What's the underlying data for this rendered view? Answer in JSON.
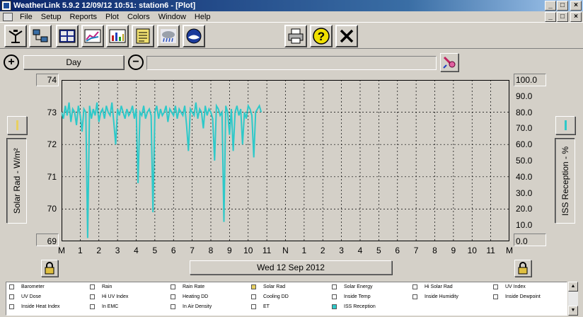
{
  "window": {
    "title": "WeatherLink 5.9.2  12/09/12  10:51: station6 - [Plot]",
    "cap_min": "_",
    "cap_max": "□",
    "cap_close": "×"
  },
  "menu": [
    "File",
    "Setup",
    "Reports",
    "Plot",
    "Colors",
    "Window",
    "Help"
  ],
  "toolbar_icons": [
    "station-icon",
    "network-icon",
    "bulletin-icon",
    "chart-icon",
    "plot-icon",
    "notes-icon",
    "weather-icon",
    "noaa-icon",
    "print-icon",
    "help-icon",
    "close-icon"
  ],
  "zoom": {
    "in_symbol": "+",
    "out_symbol": "−",
    "period_label": "Day",
    "selection_value": ""
  },
  "left_axis": {
    "title": "Solar Rad - W/m²",
    "ticks": [
      "74",
      "73",
      "72",
      "71",
      "70",
      "69"
    ]
  },
  "right_axis": {
    "title": "ISS Reception - %",
    "ticks": [
      "100.0",
      "90.0",
      "80.0",
      "70.0",
      "60.0",
      "50.0",
      "40.0",
      "30.0",
      "20.0",
      "10.0",
      "0.0"
    ]
  },
  "x_axis": {
    "ticks": [
      "M",
      "1",
      "2",
      "3",
      "4",
      "5",
      "6",
      "7",
      "8",
      "9",
      "10",
      "11",
      "N",
      "1",
      "2",
      "3",
      "4",
      "5",
      "6",
      "7",
      "8",
      "9",
      "10",
      "11",
      "M"
    ]
  },
  "date_label": "Wed 12 Sep 2012",
  "series_color": "#2ec9c9",
  "chart_data": {
    "type": "line",
    "series": [
      {
        "x": [
          0,
          0.1,
          0.2,
          0.3,
          0.4,
          0.5,
          0.6,
          0.7,
          0.8,
          0.9,
          1.0,
          1.1,
          1.2,
          1.3,
          1.4,
          1.5,
          1.6,
          1.7,
          1.8,
          1.9,
          2.0,
          2.1,
          2.2,
          2.3,
          2.4,
          2.5,
          2.6,
          2.7,
          2.8,
          2.9,
          3.0,
          3.1,
          3.2,
          3.3,
          3.4,
          3.5,
          3.6,
          3.7,
          3.8,
          3.9,
          4.0,
          4.1,
          4.2,
          4.3,
          4.4,
          4.5,
          4.6,
          4.7,
          4.8,
          4.9,
          5.0,
          5.1,
          5.2,
          5.3,
          5.4,
          5.5,
          5.6,
          5.7,
          5.8,
          5.9,
          6.0,
          6.1,
          6.2,
          6.3,
          6.4,
          6.5,
          6.6,
          6.7,
          6.8,
          6.9,
          7.0,
          7.1,
          7.2,
          7.3,
          7.4,
          7.5,
          7.6,
          7.7,
          7.8,
          7.9,
          8.0,
          8.1,
          8.2,
          8.3,
          8.4,
          8.5,
          8.6,
          8.7,
          8.8,
          8.9,
          9.0,
          9.1,
          9.2,
          9.3,
          9.4,
          9.5,
          9.6,
          9.7,
          9.8,
          9.9,
          10.0,
          10.1,
          10.2,
          10.3,
          10.4,
          10.5,
          10.6,
          10.7
        ],
        "values": [
          73.0,
          72.8,
          73.2,
          72.9,
          73.3,
          72.7,
          73.1,
          73.0,
          72.6,
          73.2,
          72.9,
          72.4,
          73.1,
          73.0,
          69.1,
          73.2,
          72.8,
          73.1,
          72.9,
          73.3,
          72.7,
          73.0,
          73.1,
          72.8,
          73.2,
          73.0,
          72.9,
          73.3,
          72.7,
          72.0,
          73.1,
          72.9,
          73.2,
          73.0,
          72.8,
          73.1,
          72.9,
          73.0,
          73.2,
          72.8,
          73.1,
          70.8,
          73.0,
          72.9,
          73.2,
          72.8,
          73.0,
          73.1,
          72.9,
          69.9,
          73.0,
          73.2,
          72.8,
          73.1,
          72.9,
          73.0,
          73.2,
          72.7,
          73.1,
          73.0,
          72.9,
          73.2,
          72.8,
          73.1,
          73.0,
          72.9,
          73.2,
          72.6,
          71.8,
          73.1,
          73.0,
          72.9,
          73.3,
          72.8,
          73.1,
          73.0,
          72.5,
          73.2,
          72.9,
          73.1,
          73.0,
          72.8,
          71.5,
          73.2,
          73.1,
          72.9,
          73.0,
          69.6,
          73.2,
          73.0,
          72.3,
          73.1,
          71.8,
          73.0,
          73.2,
          72.9,
          73.1,
          72.0,
          73.0,
          72.8,
          73.2,
          73.1,
          72.9,
          71.6,
          73.0,
          73.1,
          73.2,
          73.0
        ],
        "y_axis": "left"
      }
    ],
    "xlim": [
      0,
      24
    ],
    "ylim": [
      69,
      74
    ],
    "y2lim": [
      0,
      100
    ],
    "grid": true
  },
  "legend": [
    [
      "Barometer",
      "Rain",
      "Rain Rate",
      "Solar Rad",
      "Solar Energy",
      "Hi Solar Rad",
      "UV Index"
    ],
    [
      "UV Dose",
      "Hi UV Index",
      "Heating DD",
      "Cooling DD",
      "Inside Temp",
      "Inside Humidity",
      "Inside Dewpoint"
    ],
    [
      "Inside Heat Index",
      "In EMC",
      "In Air Density",
      "ET",
      "ISS Reception",
      "",
      ""
    ]
  ],
  "legend_checked": {
    "Solar Rad": "#e8d060",
    "ISS Reception": "#2ec9c9"
  }
}
